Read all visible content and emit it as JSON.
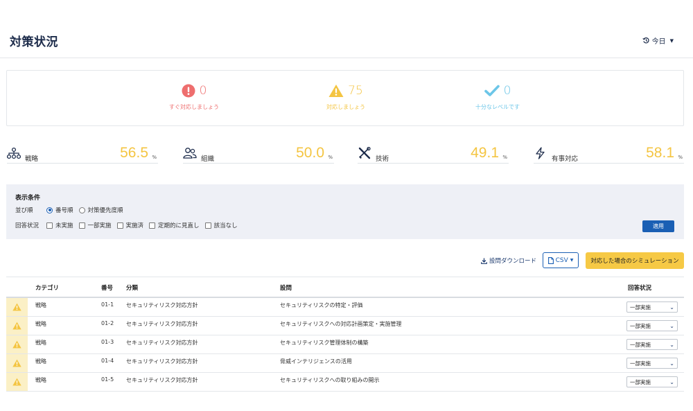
{
  "header": {
    "title": "対策状況",
    "date_label": "今日"
  },
  "summary": [
    {
      "count": "0",
      "label": "すぐ対応しましょう",
      "color": "#ee6e6e",
      "icon": "exclamation-circle-icon"
    },
    {
      "count": "75",
      "label": "対応しましょう",
      "color": "#f4c542",
      "icon": "warning-triangle-icon"
    },
    {
      "count": "0",
      "label": "十分なレベルです",
      "color": "#6cc6e8",
      "icon": "checkmark-icon"
    }
  ],
  "categories": [
    {
      "name": "戦略",
      "value": "56.5",
      "unit": "%",
      "icon": "network-icon"
    },
    {
      "name": "組織",
      "value": "50.0",
      "unit": "%",
      "icon": "people-icon"
    },
    {
      "name": "技術",
      "value": "49.1",
      "unit": "%",
      "icon": "tools-icon"
    },
    {
      "name": "有事対応",
      "value": "58.1",
      "unit": "%",
      "icon": "lightning-icon"
    }
  ],
  "filter": {
    "title": "表示条件",
    "sort_label": "並び順",
    "sort_options": [
      "番号順",
      "対策優先度順"
    ],
    "sort_selected": "番号順",
    "status_label": "回答状況",
    "status_options": [
      "未実施",
      "一部実施",
      "実施済",
      "定期的に見直し",
      "該当なし"
    ],
    "apply_label": "適用"
  },
  "actions": {
    "download_label": "設問ダウンロード",
    "csv_label": "CSV",
    "simulation_label": "対応した場合のシミュレーション"
  },
  "table": {
    "headers": {
      "category": "カテゴリ",
      "number": "番号",
      "classification": "分類",
      "question": "設問",
      "status": "回答状況"
    },
    "rows": [
      {
        "category": "戦略",
        "number": "01-1",
        "classification": "セキュリティリスク対応方針",
        "question": "セキュリティリスクの特定・評価",
        "status": "一部実施"
      },
      {
        "category": "戦略",
        "number": "01-2",
        "classification": "セキュリティリスク対応方針",
        "question": "セキュリティリスクへの対応計画策定・実施管理",
        "status": "一部実施"
      },
      {
        "category": "戦略",
        "number": "01-3",
        "classification": "セキュリティリスク対応方針",
        "question": "セキュリティリスク管理体制の構築",
        "status": "一部実施"
      },
      {
        "category": "戦略",
        "number": "01-4",
        "classification": "セキュリティリスク対応方針",
        "question": "脅威インテリジェンスの活用",
        "status": "一部実施"
      },
      {
        "category": "戦略",
        "number": "01-5",
        "classification": "セキュリティリスク対応方針",
        "question": "セキュリティリスクへの取り組みの開示",
        "status": "一部実施"
      }
    ]
  }
}
